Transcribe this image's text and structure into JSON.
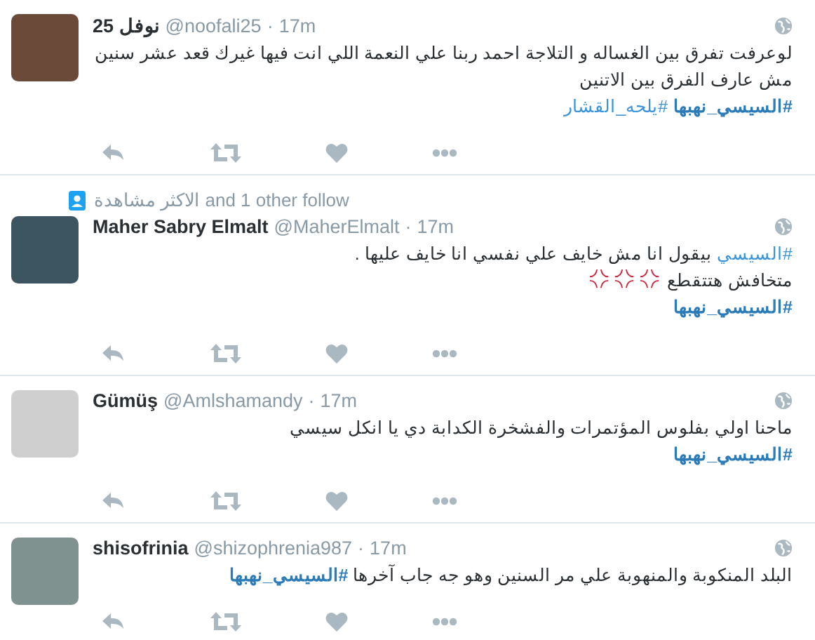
{
  "tweets": [
    {
      "name": "نوفل 25",
      "handle": "@noofali25",
      "separator": "·",
      "time": "17m",
      "lines": [
        [
          {
            "kind": "text",
            "text": "لوعرفت تفرق بين الغساله و التلاجة احمد ربنا علي النعمة اللي انت فيها غيرك قعد عشر سنين مش عارف الفرق بين الاتنين"
          }
        ],
        [
          {
            "kind": "hashtag",
            "text": "#السيسي_نهبها",
            "bold": true
          },
          {
            "kind": "hashtag",
            "text": "#يلحه_القشار",
            "bold": false
          }
        ]
      ]
    },
    {
      "context": "الاكثر مشاهدة and 1 other follow",
      "name": "Maher Sabry Elmalt",
      "handle": "@MaherElmalt",
      "separator": "·",
      "time": "17m",
      "lines": [
        [
          {
            "kind": "hashtag",
            "text": "#السيسي",
            "bold": false
          },
          {
            "kind": "text",
            "text": " بيقول انا مش خايف علي نفسي انا خايف عليها ."
          }
        ],
        [
          {
            "kind": "text",
            "text": "متخافش هتتقطع "
          },
          {
            "kind": "anger"
          },
          {
            "kind": "anger"
          },
          {
            "kind": "anger"
          }
        ],
        [
          {
            "kind": "hashtag",
            "text": "#السيسي_نهبها",
            "bold": true
          }
        ]
      ]
    },
    {
      "name": "Gümüş",
      "handle": "@Amlshamandy",
      "separator": "·",
      "time": "17m",
      "lines": [
        [
          {
            "kind": "text",
            "text": "ماحنا اولي بفلوس المؤتمرات والفشخرة الكدابة دي يا انكل سيسي"
          }
        ],
        [
          {
            "kind": "hashtag",
            "text": "#السيسي_نهبها",
            "bold": true
          }
        ]
      ]
    },
    {
      "name": "shisofrinia",
      "handle": "@shizophrenia987",
      "separator": "·",
      "time": "17m",
      "lines": [
        [
          {
            "kind": "text",
            "text": "البلد المنكوبة والمنهوبة علي مر السنين وهو جه جاب آخرها "
          },
          {
            "kind": "hashtag",
            "text": "#السيسي_نهبها",
            "bold": true
          }
        ]
      ]
    }
  ]
}
